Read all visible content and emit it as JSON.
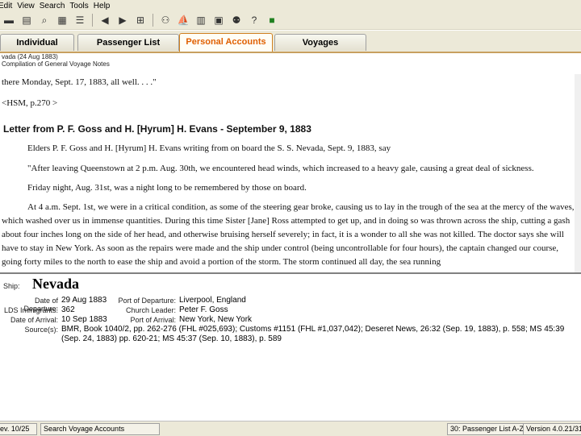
{
  "menu": [
    "Edit",
    "View",
    "Search",
    "Tools",
    "Help"
  ],
  "toolbar_icons": [
    "save-icon",
    "print-icon",
    "find-icon",
    "table-icon",
    "list-icon",
    "back-arrow-icon",
    "forward-arrow-icon",
    "grid-icon",
    "people-icon",
    "ship-icon",
    "chart-icon",
    "book-icon",
    "people2-icon",
    "help-icon",
    "exit-icon"
  ],
  "tabs": [
    "Individual",
    "Passenger List",
    "Personal Accounts",
    "Voyages"
  ],
  "header": {
    "line1": "vada (24 Aug 1883)",
    "line2": "Compilation of General Voyage Notes"
  },
  "doc": {
    "line1": "there Monday, Sept. 17, 1883, all well. . . .\"",
    "line2": "<HSM, p.270 >",
    "heading": "Letter from P. F. Goss and H. [Hyrum] H. Evans - September 9, 1883",
    "p1": "Elders P. F. Goss and H. [Hyrum] H. Evans writing from on board the S. S. Nevada, Sept. 9, 1883, say",
    "p2": "\"After leaving Queenstown at 2 p.m. Aug. 30th, we encountered head winds, which increased to a heavy gale, causing a great deal of sickness.",
    "p3": "Friday night, Aug. 31st, was a night long to be remembered by those on board.",
    "p4": "At 4 a.m. Sept. 1st, we were in a critical condition, as some of the steering gear broke, causing us to lay in the trough of the sea at the mercy of the waves, which washed over us in immense quantities. During this time Sister [Jane] Ross attempted to get up, and in doing so was thrown across the ship, cutting a gash about four inches long on the side of her head, and otherwise bruising herself severely; in fact, it is a wonder to all she was not killed. The doctor says she will have to stay in New York. As soon as the repairs were made and the ship under control (being uncontrollable for four hours), the captain changed our course, going forty miles to the north to ease the ship and avoid a portion of the storm. The storm continued all day, the sea running"
  },
  "ship": {
    "label": "Ship:",
    "name": "Nevada",
    "departure_label": "Date of Departure:",
    "departure": "29 Aug 1883",
    "immigrants_label": "LDS Immigrants:",
    "immigrants": "362",
    "arrival_label": "Date of Arrival:",
    "arrival": "10 Sep 1883",
    "port_dep_label": "Port of Departure:",
    "port_dep": "Liverpool, England",
    "leader_label": "Church Leader:",
    "leader": "Peter F. Goss",
    "port_arr_label": "Port of Arrival:",
    "port_arr": "New York, New York",
    "sources_label": "Source(s):",
    "sources1": "BMR, Book 1040/2, pp. 262-276 (FHL #025,693); Customs #1151 (FHL #1,037,042); Deseret News, 26:32 (Sep. 19, 1883), p. 558; MS 45:39",
    "sources2": "(Sep. 24, 1883) pp. 620-21; MS 45:37 (Sep. 10, 1883), p. 589"
  },
  "status": {
    "left": "ev. 10/25",
    "search": "Search Voyage Accounts",
    "right1": "30: Passenger List A-Z",
    "version": "Version 4.0.21/31/"
  }
}
